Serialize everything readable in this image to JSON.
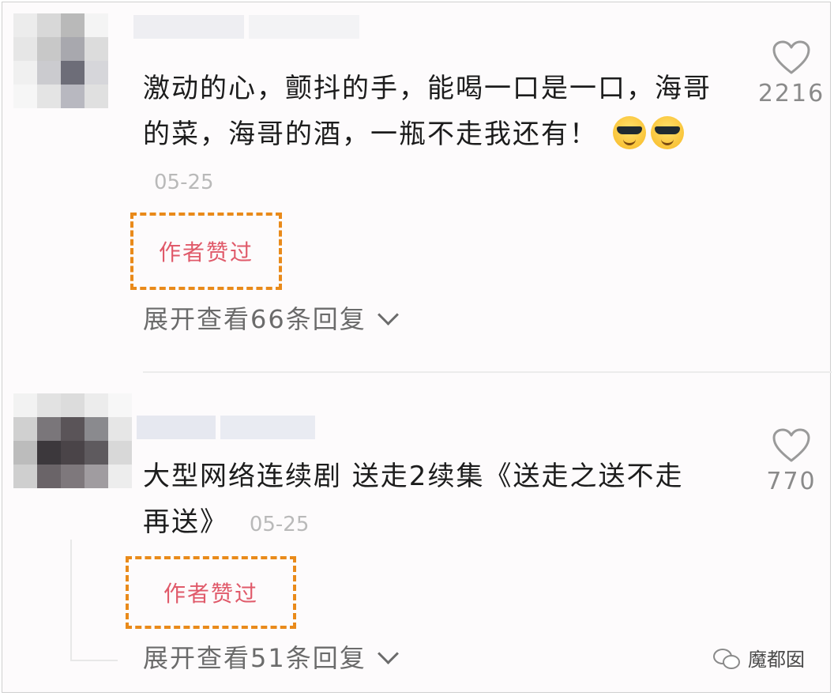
{
  "comments": [
    {
      "text": "激动的心，颤抖的手，能喝一口是一口，海哥的菜，海哥的酒，一瓶不走我还有！",
      "emojis": [
        "cool-face-emoji",
        "cool-face-emoji"
      ],
      "time": "05-25",
      "badge": "作者赞过",
      "expand": "展开查看66条回复",
      "likes": "2216"
    },
    {
      "text": "大型网络连续剧 送走2续集《送走之送不走再送》",
      "time": "05-25",
      "badge": "作者赞过",
      "expand": "展开查看51条回复",
      "likes": "770"
    }
  ],
  "watermark": {
    "text": "魔都囡",
    "icon": "wechat-icon"
  },
  "colors": {
    "badge_border": "#e98a1a",
    "badge_text": "#e05a6a",
    "time": "#b9b9b9"
  }
}
